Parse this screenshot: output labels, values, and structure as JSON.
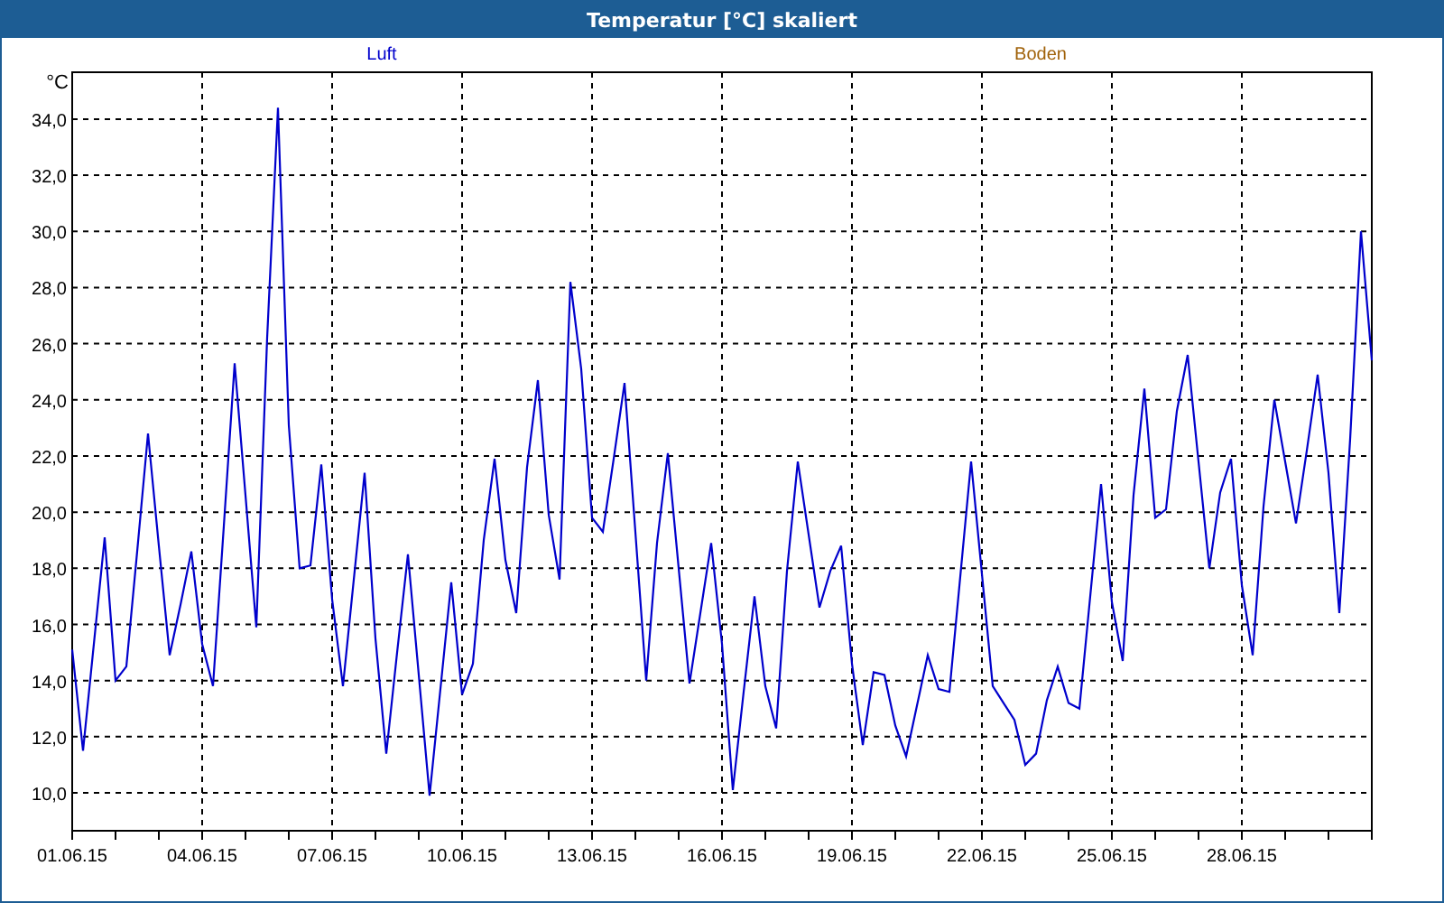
{
  "window": {
    "title": "Temperatur [°C] skaliert"
  },
  "legend": [
    {
      "label": "Boden",
      "color": "#a0620a"
    }
  ],
  "chart": {
    "chart_data": {
      "type": "line",
      "grid": true,
      "ylabel": "°C",
      "ylim": [
        8.65,
        35.67
      ],
      "categories": [
        "01.06.15",
        null,
        null,
        null,
        null,
        null,
        null,
        null,
        null,
        null,
        null,
        null,
        "04.06.15",
        null,
        null,
        null,
        null,
        null,
        null,
        null,
        null,
        null,
        null,
        null,
        "07.06.15",
        null,
        null,
        null,
        null,
        null,
        null,
        null,
        null,
        null,
        null,
        null,
        "10.06.15",
        null,
        null,
        null,
        null,
        null,
        null,
        null,
        null,
        null,
        null,
        null,
        "13.06.15",
        null,
        null,
        null,
        null,
        null,
        null,
        null,
        null,
        null,
        null,
        null,
        "16.06.15",
        null,
        null,
        null,
        null,
        null,
        null,
        null,
        null,
        null,
        null,
        null,
        "19.06.15",
        null,
        null,
        null,
        null,
        null,
        null,
        null,
        null,
        null,
        null,
        null,
        "22.06.15",
        null,
        null,
        null,
        null,
        null,
        null,
        null,
        null,
        null,
        null,
        null,
        "25.06.15",
        null,
        null,
        null,
        null,
        null,
        null,
        null,
        null,
        null,
        null,
        null,
        "28.06.15",
        null,
        null,
        null,
        null,
        null,
        null,
        null,
        null,
        null,
        null,
        null,
        null
      ],
      "series": [
        {
          "name": "Luft",
          "color": "#0000cc",
          "values": [
            15.1,
            11.5,
            15.3,
            19.1,
            14.0,
            14.5,
            18.6,
            22.8,
            18.8,
            14.9,
            16.7,
            18.6,
            15.3,
            13.8,
            19.5,
            25.3,
            20.6,
            15.9,
            26.2,
            34.4,
            23.1,
            18.0,
            18.1,
            21.7,
            16.9,
            13.8,
            17.6,
            21.4,
            15.5,
            11.4,
            15.0,
            18.5,
            14.2,
            9.9,
            13.7,
            17.5,
            13.5,
            14.6,
            19.0,
            21.9,
            18.3,
            16.4,
            21.6,
            24.7,
            19.9,
            17.6,
            28.2,
            25.1,
            19.8,
            19.3,
            21.9,
            24.6,
            19.3,
            14.0,
            18.9,
            22.1,
            18.0,
            13.9,
            16.4,
            18.9,
            15.3,
            10.1,
            13.6,
            17.0,
            13.8,
            12.3,
            17.9,
            21.8,
            19.2,
            16.6,
            17.9,
            18.8,
            14.6,
            11.7,
            14.3,
            14.2,
            12.4,
            11.3,
            13.1,
            14.9,
            13.7,
            13.6,
            17.7,
            21.8,
            17.8,
            13.8,
            13.2,
            12.6,
            11.0,
            11.4,
            13.3,
            14.5,
            13.2,
            13.0,
            17.0,
            21.0,
            16.8,
            14.7,
            20.6,
            24.4,
            19.8,
            20.1,
            23.6,
            25.6,
            21.8,
            18.0,
            20.7,
            21.9,
            17.4,
            14.9,
            20.2,
            24.0,
            21.8,
            19.6,
            22.2,
            24.9,
            21.4,
            16.4,
            22.6,
            30.0,
            25.4
          ]
        }
      ],
      "yticks": [
        {
          "value": 10,
          "label": "10,0"
        },
        {
          "value": 12,
          "label": "12,0"
        },
        {
          "value": 14,
          "label": "14,0"
        },
        {
          "value": 16,
          "label": "16,0"
        },
        {
          "value": 18,
          "label": "18,0"
        },
        {
          "value": 20,
          "label": "20,0"
        },
        {
          "value": 22,
          "label": "22,0"
        },
        {
          "value": 24,
          "label": "24,0"
        },
        {
          "value": 26,
          "label": "26,0"
        },
        {
          "value": 28,
          "label": "28,0"
        },
        {
          "value": 30,
          "label": "30,0"
        },
        {
          "value": 32,
          "label": "32,0"
        },
        {
          "value": 34,
          "label": "34,0"
        }
      ]
    }
  }
}
